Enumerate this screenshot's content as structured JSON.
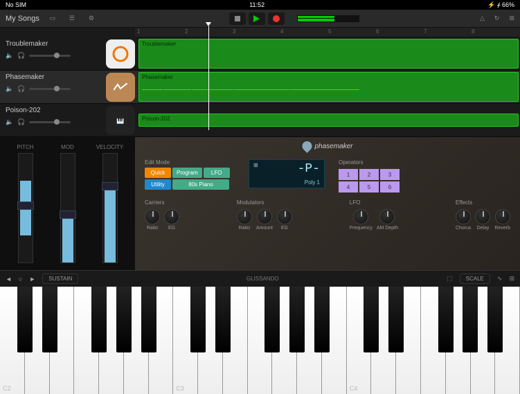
{
  "status": {
    "carrier": "No SIM",
    "time": "11:52",
    "battery": "66%"
  },
  "toolbar": {
    "title": "My Songs"
  },
  "ruler": {
    "marks": [
      "1",
      "2",
      "3",
      "4",
      "5",
      "6",
      "7",
      "8"
    ]
  },
  "tracks": [
    {
      "name": "Troublemaker",
      "clip": "Troublemaker"
    },
    {
      "name": "Phasemaker",
      "clip": "Phasemaker"
    },
    {
      "name": "Poison-202",
      "clip": "Poison-202"
    }
  ],
  "controls": {
    "pitch": "PITCH",
    "mod": "MOD",
    "velocity": "VELOCITY"
  },
  "synth": {
    "brand": "phasemaker",
    "edit_label": "Edit Mode",
    "edit_buttons": [
      "Quick",
      "Program",
      "LFO",
      "Utility",
      "80s Piano"
    ],
    "display": {
      "patch": "-P-",
      "mode": "Poly",
      "val": "1"
    },
    "ops_label": "Operators",
    "ops": [
      "1",
      "2",
      "3",
      "4",
      "5",
      "6"
    ],
    "groups": {
      "carriers": "Carriers",
      "modulators": "Modulators",
      "lfo": "LFO",
      "effects": "Effects"
    },
    "knobs": {
      "ratio": "Ratio",
      "eg": "EG",
      "amount": "Amount",
      "frequency": "Frequency",
      "amdepth": "AM Depth",
      "chorus": "Chorus",
      "delay": "Delay",
      "reverb": "Reverb"
    }
  },
  "keyboard_bar": {
    "sustain": "SUSTAIN",
    "glissando": "GLISSANDO",
    "scale": "SCALE",
    "octaves": [
      "C2",
      "C3",
      "C4"
    ]
  }
}
